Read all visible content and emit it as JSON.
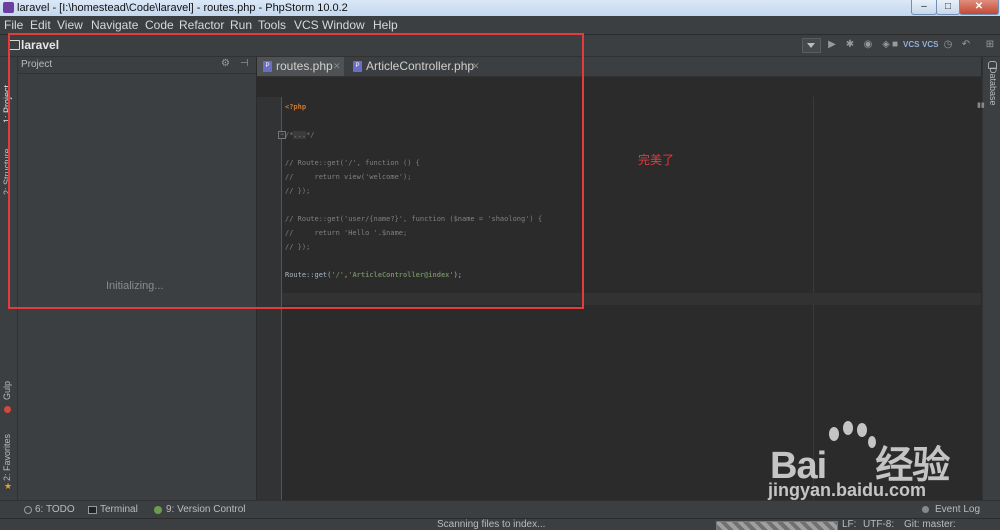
{
  "window": {
    "title": "laravel - [I:\\homestead\\Code\\laravel] - routes.php - PhpStorm 10.0.2",
    "controls": {
      "minimize": "–",
      "maximize": "□",
      "close": "✕"
    }
  },
  "menu": [
    "File",
    "Edit",
    "View",
    "Navigate",
    "Code",
    "Refactor",
    "Run",
    "Tools",
    "VCS",
    "Window",
    "Help"
  ],
  "navbar": {
    "project_name": "laravel",
    "toolbar_icons": [
      "run-config-dropdown",
      "run-icon",
      "debug-icon",
      "coverage-icon",
      "profile-icon",
      "stop-icon",
      "vcs-update-icon",
      "vcs-commit-icon",
      "vcs-history-icon",
      "revert-icon"
    ],
    "vcs_label": "VCS"
  },
  "left_tool_tabs": {
    "project": "1: Project",
    "structure": "2: Structure",
    "gulp": "Gulp",
    "favorites": "2: Favorites"
  },
  "project_panel": {
    "title": "Project",
    "gear_glyph": "⚙",
    "hide_glyph": "⊣",
    "status": "Initializing..."
  },
  "editor_tabs": [
    {
      "label": "routes.php",
      "active": true
    },
    {
      "label": "ArticleController.php",
      "active": false
    }
  ],
  "tab_close_glyph": "✕",
  "code": {
    "lines": [
      "<?php",
      "",
      "/*...*/",
      "",
      "// Route::get('/', function () {",
      "//     return view('welcome');",
      "// });",
      "",
      "// Route::get('user/{name?}', function ($name = 'shaolong') {",
      "//     return 'Hello '.$name;",
      "// });",
      "",
      "Route::get('/','ArticleController@index');"
    ],
    "tokens": {
      "php_open": "<?php",
      "fold_start": "/*",
      "fold_dots": "...",
      "fold_end": "*/",
      "route_prefix": "Route::get(",
      "route_arg1": "'/'",
      "route_comma": ",",
      "route_arg2": "'ArticleController@index'",
      "route_suffix": ");"
    }
  },
  "right_tool_tabs": {
    "database": "Database"
  },
  "bottom_tools": [
    {
      "label": "6: TODO"
    },
    {
      "label": "Terminal"
    },
    {
      "label": "9: Version Control"
    }
  ],
  "event_log": "Event Log",
  "status": {
    "message": "Scanning files to index...",
    "line_separator": "LF:",
    "encoding": "UTF-8:",
    "git": "Git: master:"
  },
  "annotation": {
    "text": "完美了"
  },
  "watermark": {
    "brand": "Bai du 经验",
    "url": "jingyan.baidu.com"
  },
  "colors": {
    "background": "#2b2b2b",
    "panel": "#3c3f41",
    "keyword": "#cc7832",
    "string": "#6a8759",
    "comment": "#808080",
    "annotation": "#e53b3b"
  }
}
